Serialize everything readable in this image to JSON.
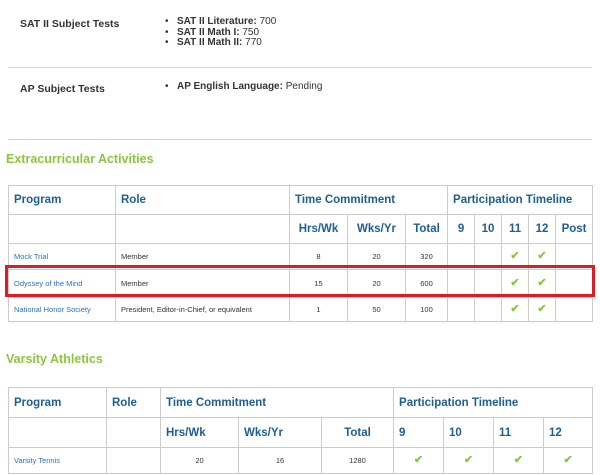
{
  "scores": [
    {
      "label": "SAT II Subject Tests",
      "items": [
        {
          "name": "SAT II Literature:",
          "value": "700"
        },
        {
          "name": "SAT II Math I:",
          "value": "750"
        },
        {
          "name": "SAT II Math II:",
          "value": "770"
        }
      ]
    },
    {
      "label": "AP Subject Tests",
      "items": [
        {
          "name": "AP English Language:",
          "value": "Pending"
        }
      ]
    }
  ],
  "extracurricular": {
    "title": "Extracurricular Activities",
    "headers": {
      "program": "Program",
      "role": "Role",
      "time_commitment": "Time Commitment",
      "participation_timeline": "Participation Timeline",
      "hrs_wk": "Hrs/Wk",
      "wks_yr": "Wks/Yr",
      "total": "Total",
      "grades": [
        "9",
        "10",
        "11",
        "12",
        "Post"
      ]
    },
    "rows": [
      {
        "program": "Mock Trial",
        "role": "Member",
        "hrs_wk": "8",
        "wks_yr": "20",
        "total": "320",
        "grades": [
          false,
          false,
          true,
          true,
          false
        ],
        "highlighted": false
      },
      {
        "program": "Odyssey of the Mind",
        "role": "Member",
        "hrs_wk": "15",
        "wks_yr": "20",
        "total": "600",
        "grades": [
          false,
          false,
          true,
          true,
          false
        ],
        "highlighted": true
      },
      {
        "program": "National Honor Society",
        "role": "President, Editor-in-Chief, or equivalent",
        "hrs_wk": "1",
        "wks_yr": "50",
        "total": "100",
        "grades": [
          false,
          false,
          true,
          true,
          false
        ],
        "highlighted": false
      }
    ]
  },
  "athletics": {
    "title": "Varsity Athletics",
    "headers": {
      "program": "Program",
      "role": "Role",
      "time_commitment": "Time Commitment",
      "participation_timeline": "Participation Timeline",
      "hrs_wk": "Hrs/Wk",
      "wks_yr": "Wks/Yr",
      "total": "Total",
      "grades": [
        "9",
        "10",
        "11",
        "12"
      ]
    },
    "rows": [
      {
        "program": "Varsity Tennis",
        "role": "",
        "hrs_wk": "20",
        "wks_yr": "16",
        "total": "1280",
        "grades": [
          true,
          true,
          true,
          true
        ]
      }
    ]
  },
  "icons": {
    "check": "check-icon"
  },
  "colors": {
    "section_title": "#8cc63f",
    "header_text": "#1f5e92",
    "link_text": "#2a72b8",
    "check": "#8cc63f",
    "highlight": "#d91f26"
  }
}
